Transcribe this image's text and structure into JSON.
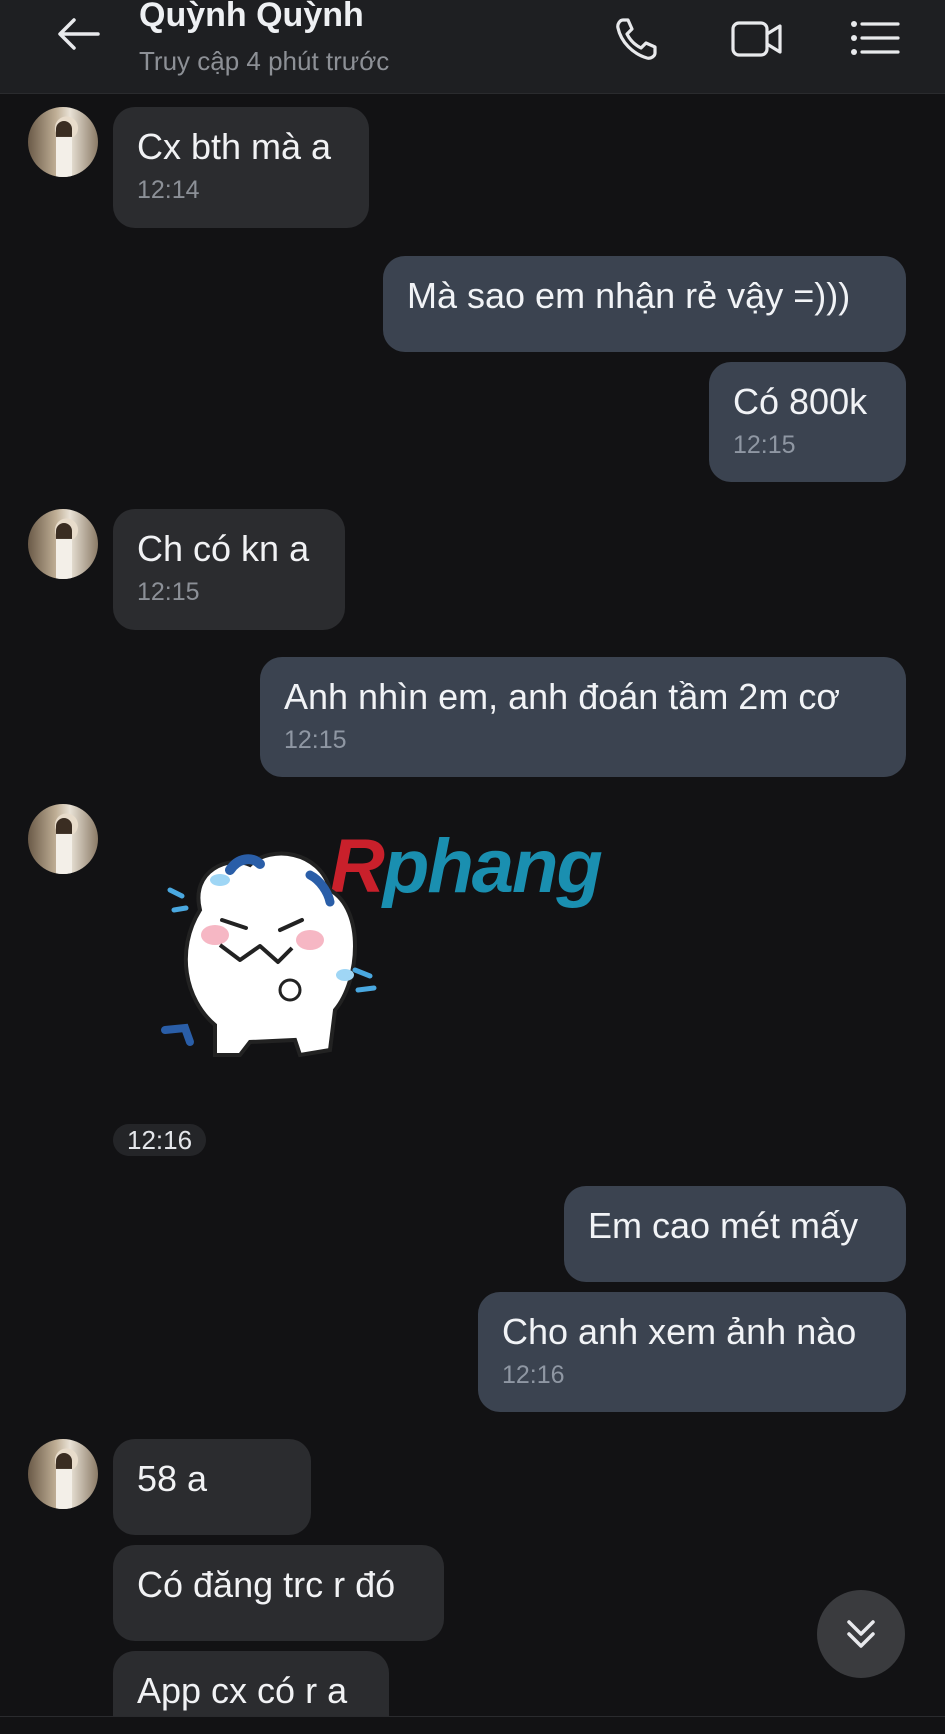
{
  "header": {
    "contact_name": "Quỳnh Quỳnh",
    "status": "Truy cập 4 phút trước",
    "icons": [
      "back-arrow-icon",
      "phone-icon",
      "video-call-icon",
      "menu-list-icon"
    ]
  },
  "messages": [
    {
      "direction": "in",
      "text": "Cx bth mà a",
      "time": "12:14"
    },
    {
      "direction": "out",
      "text": "Mà sao em nhận rẻ vậy =)))",
      "time": ""
    },
    {
      "direction": "out",
      "text": "Có 800k",
      "time": "12:15"
    },
    {
      "direction": "in",
      "text": "Ch có kn a",
      "time": "12:15"
    },
    {
      "direction": "out",
      "text": "Anh nhìn em, anh đoán tầm 2m cơ",
      "time": "12:15"
    },
    {
      "direction": "in",
      "type": "sticker",
      "sticker": "crying-cat-sticker",
      "time": "12:16"
    },
    {
      "direction": "out",
      "text": "Em cao mét mấy",
      "time": ""
    },
    {
      "direction": "out",
      "text": "Cho anh xem ảnh nào",
      "time": "12:16"
    },
    {
      "direction": "in",
      "text": "58 a",
      "time": ""
    },
    {
      "direction": "in",
      "text": "Có đăng trc r đó",
      "time": ""
    },
    {
      "direction": "in",
      "text": "App cx có r a",
      "time": ""
    }
  ],
  "watermark": {
    "first": "R",
    "rest": "phang"
  },
  "colors": {
    "background": "#121214",
    "incoming_bubble": "#2b2c2f",
    "outgoing_bubble": "#3b4350",
    "watermark_red": "#c9202b",
    "watermark_blue": "#1a8fb0"
  }
}
